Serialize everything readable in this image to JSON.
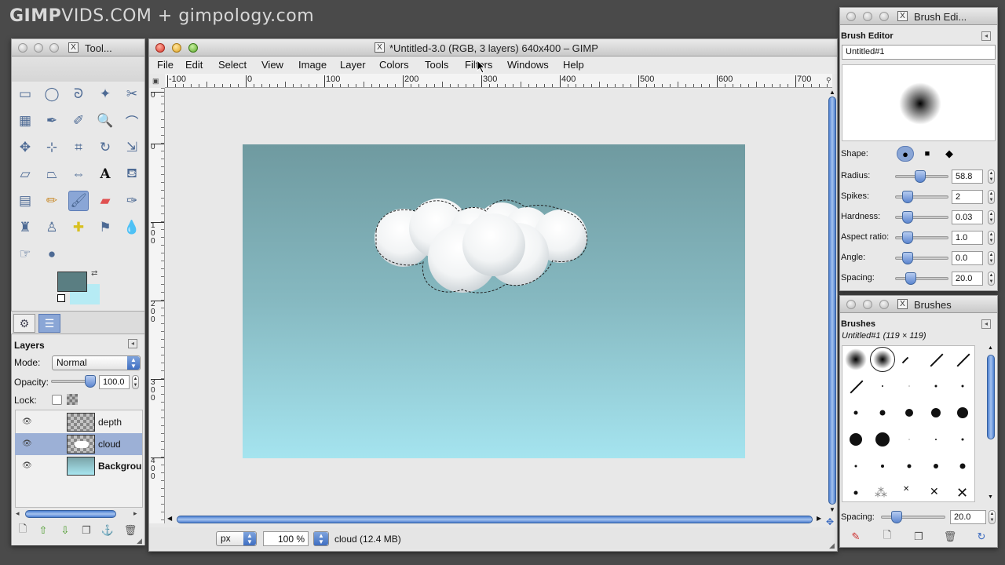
{
  "watermark": {
    "part1": "GIMP",
    "part2": "VIDS",
    "part3": ".COM",
    "plus": "+",
    "part4": "gimpology.com"
  },
  "toolbox": {
    "title": "Tool...",
    "tools": [
      "rect-select-icon",
      "ellipse-select-icon",
      "lasso-icon",
      "fuzzy-select-icon",
      "scissors-icon",
      "color-select-icon",
      "paths-icon",
      "color-picker-icon",
      "zoom-icon",
      "measure-icon",
      "move-icon",
      "align-icon",
      "crop-icon",
      "rotate-icon",
      "scale-icon",
      "shear-icon",
      "perspective-icon",
      "flip-icon",
      "text-icon",
      "bucket-fill-icon",
      "blend-icon",
      "pencil-icon",
      "paintbrush-icon",
      "eraser-icon",
      "airbrush-icon",
      "ink-icon",
      "clone-icon",
      "heal-icon",
      "perspective-clone-icon",
      "blur-icon",
      "smudge-icon",
      "dodge-icon"
    ],
    "fg_color": "#5a7e82",
    "bg_color": "#b6ebf4"
  },
  "layers_panel": {
    "title": "Layers",
    "mode_label": "Mode:",
    "mode_value": "Normal",
    "opacity_label": "Opacity:",
    "opacity_value": "100.0",
    "opacity": 1.0,
    "lock_label": "Lock:",
    "layers": [
      {
        "name": "depth",
        "visible": true,
        "selected": false
      },
      {
        "name": "cloud",
        "visible": true,
        "selected": true
      },
      {
        "name": "Backgrou",
        "visible": true,
        "selected": false
      }
    ]
  },
  "image_window": {
    "title": "*Untitled-3.0 (RGB, 3 layers) 640x400 – GIMP",
    "menu": [
      "File",
      "Edit",
      "Select",
      "View",
      "Image",
      "Layer",
      "Colors",
      "Tools",
      "Filters",
      "Windows",
      "Help"
    ],
    "ruler_h": [
      "-100",
      "0",
      "100",
      "200",
      "300",
      "400",
      "500",
      "600",
      "700"
    ],
    "ruler_v": [
      "0",
      "0",
      "1 0 0",
      "2 0 0",
      "3 0 0",
      "4 0 0"
    ],
    "unit": "px",
    "zoom": "100 %",
    "status": "cloud (12.4 MB)"
  },
  "brush_editor": {
    "window_title": "Brush Edi...",
    "panel_title": "Brush Editor",
    "brush_name": "Untitled#1",
    "shape_label": "Shape:",
    "params": [
      {
        "label": "Radius:",
        "value": "58.8",
        "level": 0.38
      },
      {
        "label": "Spikes:",
        "value": "2",
        "level": 0.15
      },
      {
        "label": "Hardness:",
        "value": "0.03",
        "level": 0.15
      },
      {
        "label": "Aspect ratio:",
        "value": "1.0",
        "level": 0.15
      },
      {
        "label": "Angle:",
        "value": "0.0",
        "level": 0.15
      },
      {
        "label": "Spacing:",
        "value": "20.0",
        "level": 0.2
      }
    ]
  },
  "brushes": {
    "window_title": "Brushes",
    "panel_title": "Brushes",
    "current": "Untitled#1 (119 × 119)",
    "spacing_label": "Spacing:",
    "spacing_value": "20.0"
  }
}
